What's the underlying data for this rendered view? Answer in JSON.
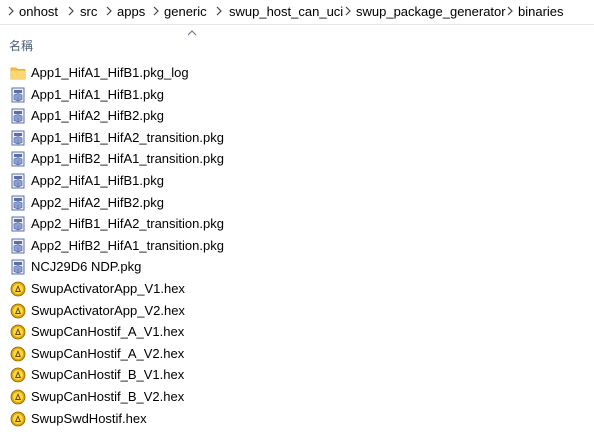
{
  "breadcrumb": [
    "onhost",
    "src",
    "apps",
    "generic",
    "swup_host_can_uci",
    "swup_package_generator",
    "binaries"
  ],
  "header": {
    "name_label": "名稱"
  },
  "files": [
    {
      "name": "App1_HifA1_HifB1.pkg_log",
      "icon": "folder-icon"
    },
    {
      "name": "App1_HifA1_HifB1.pkg",
      "icon": "package-file-icon"
    },
    {
      "name": "App1_HifA2_HifB2.pkg",
      "icon": "package-file-icon"
    },
    {
      "name": "App1_HifB1_HifA2_transition.pkg",
      "icon": "package-file-icon"
    },
    {
      "name": "App1_HifB2_HifA1_transition.pkg",
      "icon": "package-file-icon"
    },
    {
      "name": "App2_HifA1_HifB1.pkg",
      "icon": "package-file-icon"
    },
    {
      "name": "App2_HifA2_HifB2.pkg",
      "icon": "package-file-icon"
    },
    {
      "name": "App2_HifB1_HifA2_transition.pkg",
      "icon": "package-file-icon"
    },
    {
      "name": "App2_HifB2_HifA1_transition.pkg",
      "icon": "package-file-icon"
    },
    {
      "name": "NCJ29D6 NDP.pkg",
      "icon": "package-file-icon"
    },
    {
      "name": "SwupActivatorApp_V1.hex",
      "icon": "hex-file-icon"
    },
    {
      "name": "SwupActivatorApp_V2.hex",
      "icon": "hex-file-icon"
    },
    {
      "name": "SwupCanHostif_A_V1.hex",
      "icon": "hex-file-icon"
    },
    {
      "name": "SwupCanHostif_A_V2.hex",
      "icon": "hex-file-icon"
    },
    {
      "name": "SwupCanHostif_B_V1.hex",
      "icon": "hex-file-icon"
    },
    {
      "name": "SwupCanHostif_B_V2.hex",
      "icon": "hex-file-icon"
    },
    {
      "name": "SwupSwdHostif.hex",
      "icon": "hex-file-icon"
    }
  ],
  "colors": {
    "folder": "#f3c04d",
    "package": "#5a6fa8",
    "hex": "#e0a800",
    "header_text": "#4c607a"
  }
}
